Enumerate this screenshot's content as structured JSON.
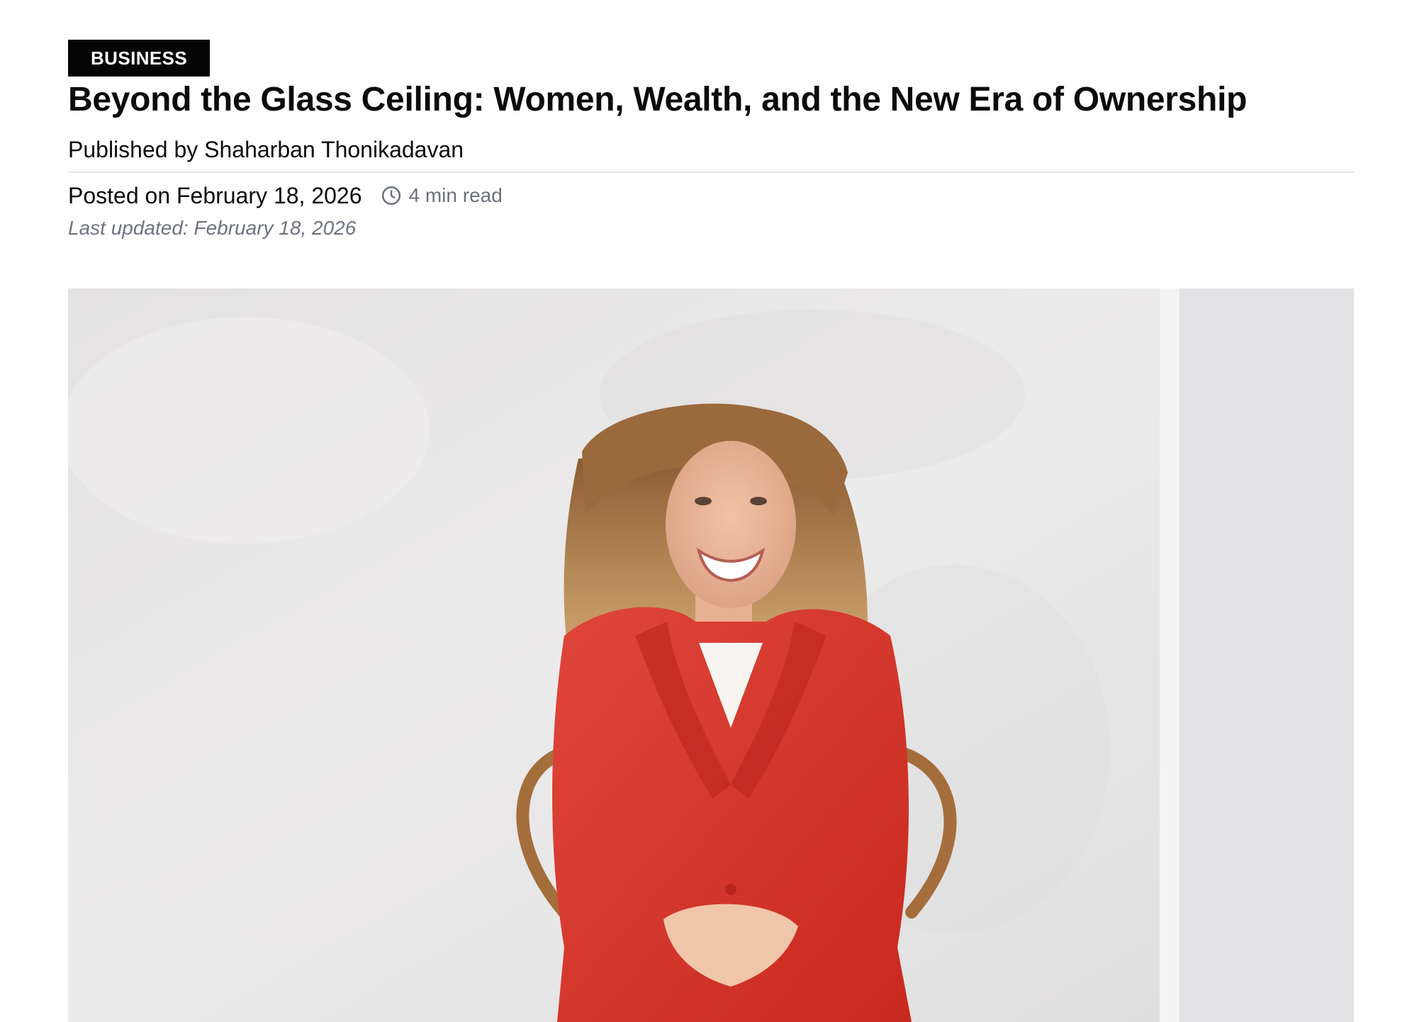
{
  "article": {
    "category": "BUSINESS",
    "title": "Beyond the Glass Ceiling: Women, Wealth, and the New Era of Ownership",
    "publisher_line": "Published by Shaharban Thonikadavan",
    "posted_on": "Posted on February 18, 2026",
    "read_time": "4 min read",
    "last_updated": "Last updated: February 18, 2026"
  },
  "icons": {
    "read_time": "clock-icon"
  },
  "colors": {
    "badge_background": "#050505",
    "badge_text": "#ffffff",
    "muted_text": "#6b7079",
    "divider": "#e2e4e8",
    "jacket_red": "#d9352b"
  }
}
